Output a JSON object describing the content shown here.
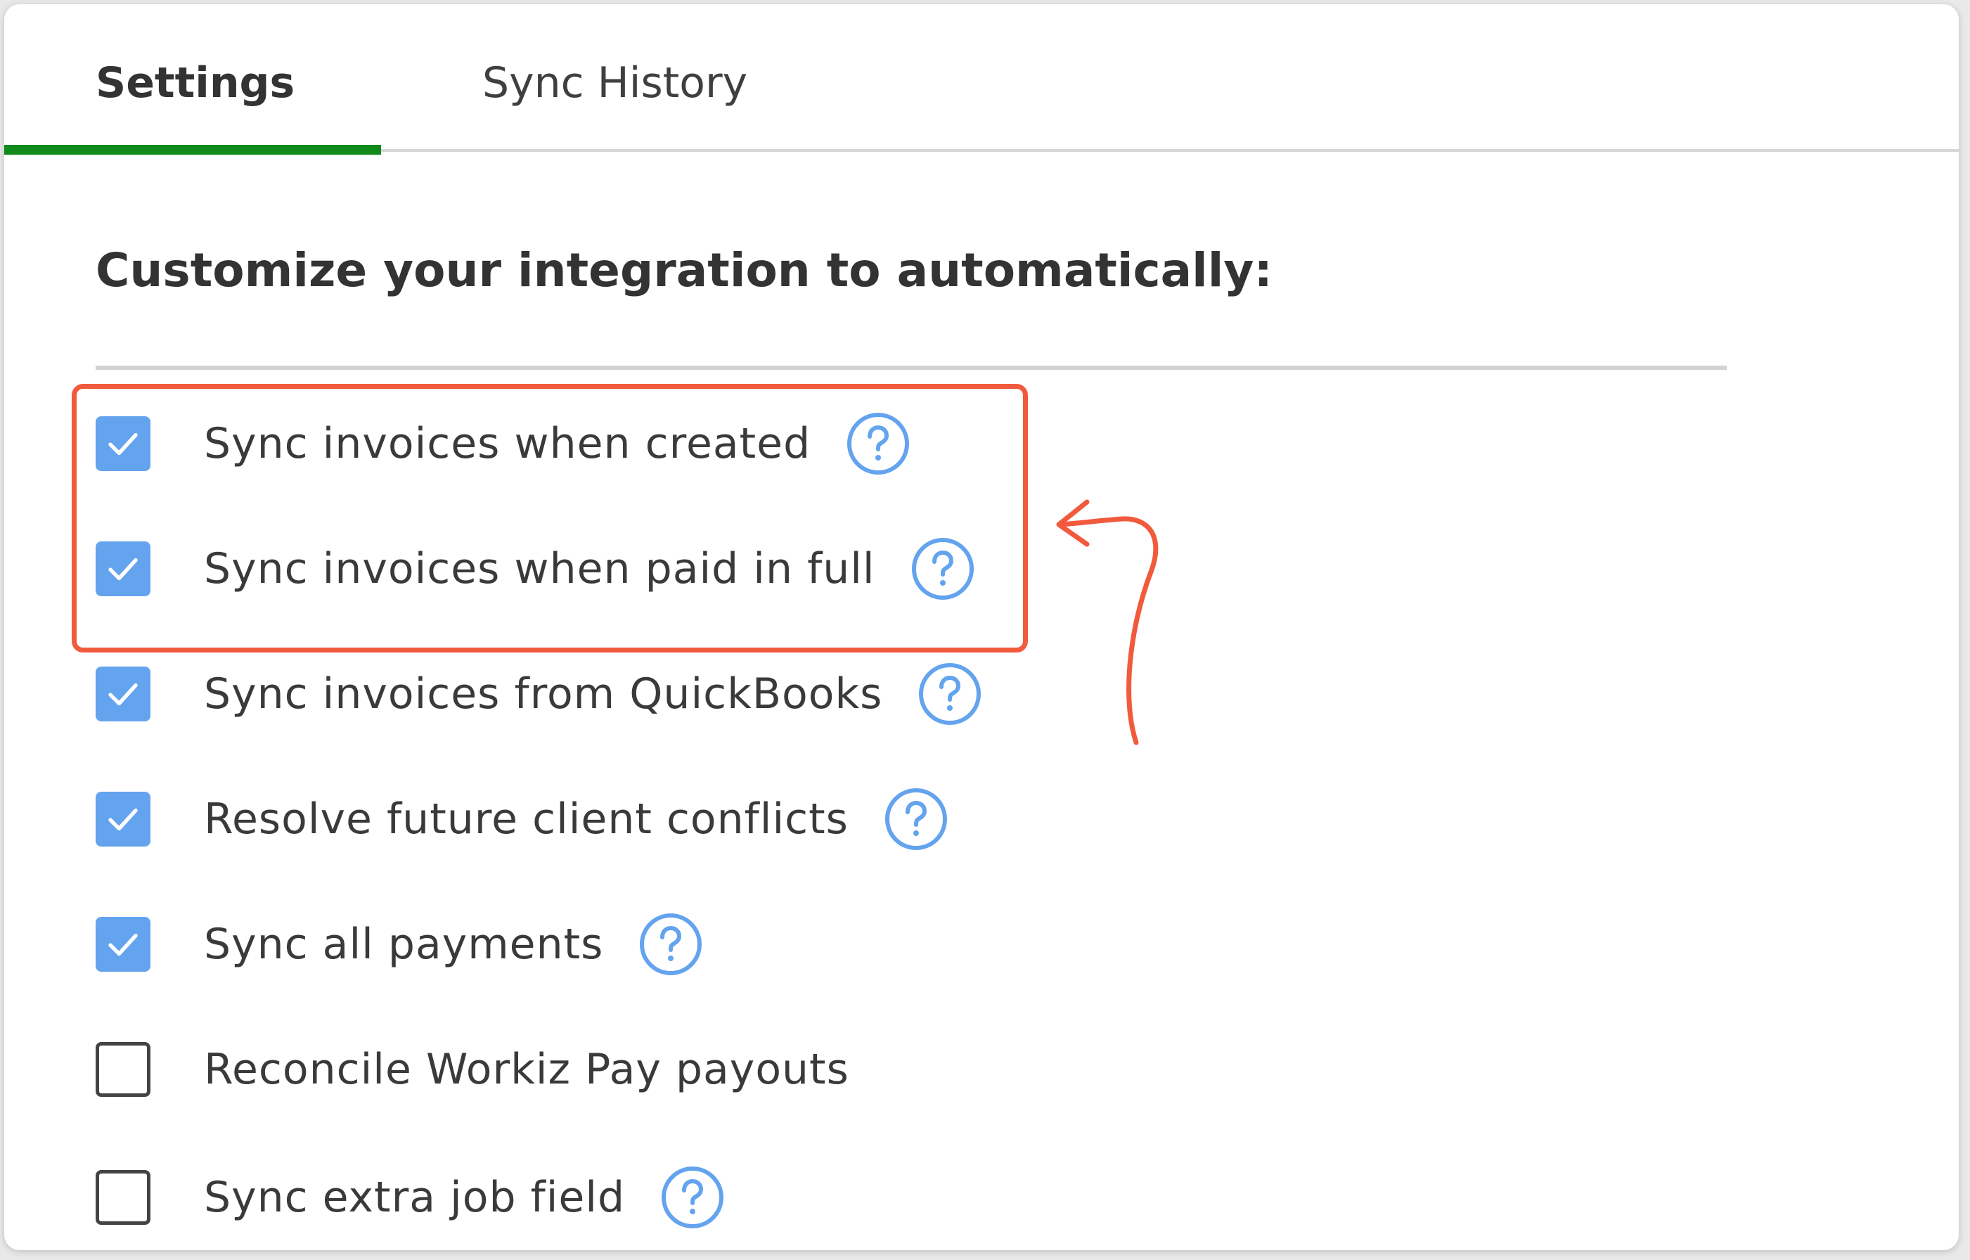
{
  "tabs": [
    {
      "label": "Settings",
      "active": true
    },
    {
      "label": "Sync History",
      "active": false
    }
  ],
  "colors": {
    "active_tab_underline": "#118a1b",
    "checkbox_checked": "#64a3ee",
    "help_icon": "#64a3ee",
    "highlight": "#f15a3d"
  },
  "heading": "Customize your integration to automatically:",
  "options": [
    {
      "label": "Sync invoices when created",
      "checked": true,
      "help": true
    },
    {
      "label": "Sync invoices when paid in full",
      "checked": true,
      "help": true
    },
    {
      "label": "Sync invoices from QuickBooks",
      "checked": true,
      "help": true
    },
    {
      "label": "Resolve future client conflicts",
      "checked": true,
      "help": true
    },
    {
      "label": "Sync all payments",
      "checked": true,
      "help": true
    },
    {
      "label": "Reconcile Workiz Pay payouts",
      "checked": false,
      "help": false
    },
    {
      "label": "Sync extra job field",
      "checked": false,
      "help": true
    }
  ],
  "icons": {
    "check": "check-icon",
    "help": "question-circle-icon",
    "annotation": "curved-arrow-icon"
  }
}
